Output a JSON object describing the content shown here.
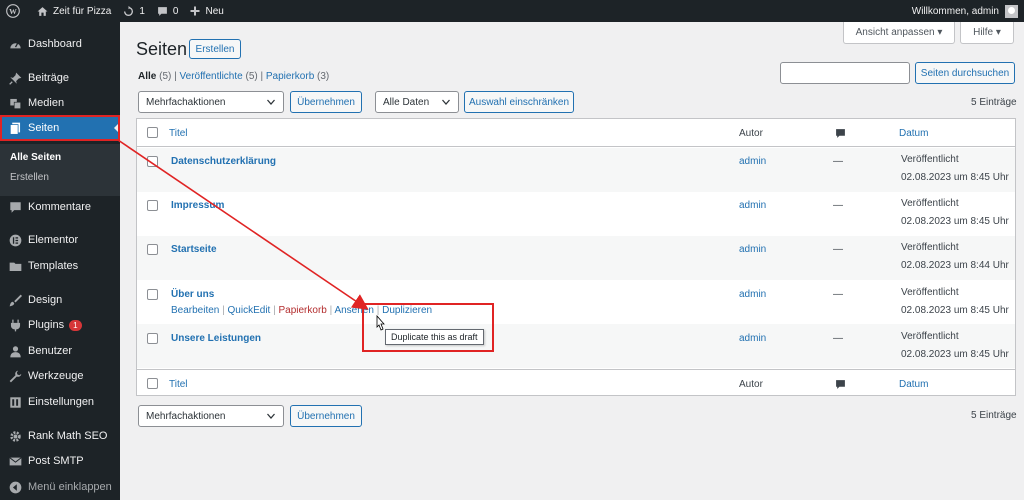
{
  "adminbar": {
    "site_name": "Zeit für Pizza",
    "updates_count": "1",
    "comments_count": "0",
    "new_label": "Neu",
    "greeting": "Willkommen, admin"
  },
  "sidebar": {
    "items": [
      {
        "label": "Dashboard",
        "icon": "dashboard-icon"
      },
      {
        "label": "Beiträge",
        "icon": "pin-icon"
      },
      {
        "label": "Medien",
        "icon": "media-icon"
      },
      {
        "label": "Seiten",
        "icon": "pages-icon"
      },
      {
        "label": "Kommentare",
        "icon": "comment-icon"
      },
      {
        "label": "Elementor",
        "icon": "elementor-icon"
      },
      {
        "label": "Templates",
        "icon": "folder-icon"
      },
      {
        "label": "Design",
        "icon": "brush-icon"
      },
      {
        "label": "Plugins",
        "icon": "plugin-icon"
      },
      {
        "label": "Benutzer",
        "icon": "user-icon"
      },
      {
        "label": "Werkzeuge",
        "icon": "wrench-icon"
      },
      {
        "label": "Einstellungen",
        "icon": "settings-icon"
      },
      {
        "label": "Rank Math SEO",
        "icon": "gear-icon"
      },
      {
        "label": "Post SMTP",
        "icon": "mail-icon"
      },
      {
        "label": "Menü einklappen",
        "icon": "collapse-icon"
      }
    ],
    "submenu": [
      "Alle Seiten",
      "Erstellen"
    ],
    "plugins_badge": "1"
  },
  "header": {
    "title": "Seiten",
    "add_new": "Erstellen",
    "screen_options": "Ansicht anpassen ▾",
    "help": "Hilfe ▾"
  },
  "filters": {
    "all": "Alle",
    "all_count": "(5)",
    "published": "Veröffentlichte",
    "published_count": "(5)",
    "trash": "Papierkorb",
    "trash_count": "(3)",
    "search_button": "Seiten durchsuchen",
    "bulk_actions": "Mehrfachaktionen",
    "apply": "Übernehmen",
    "all_dates": "Alle Daten",
    "filter_button": "Auswahl einschränken",
    "items_count": "5 Einträge"
  },
  "table": {
    "col_title": "Titel",
    "col_author": "Autor",
    "col_date": "Datum",
    "rows": [
      {
        "title": "Datenschutzerklärung",
        "author": "admin",
        "comments": "—",
        "status": "Veröffentlicht",
        "date": "02.08.2023 um 8:45 Uhr"
      },
      {
        "title": "Impressum",
        "author": "admin",
        "comments": "—",
        "status": "Veröffentlicht",
        "date": "02.08.2023 um 8:45 Uhr"
      },
      {
        "title": "Startseite",
        "author": "admin",
        "comments": "—",
        "status": "Veröffentlicht",
        "date": "02.08.2023 um 8:44 Uhr"
      },
      {
        "title": "Über uns",
        "author": "admin",
        "comments": "—",
        "status": "Veröffentlicht",
        "date": "02.08.2023 um 8:45 Uhr"
      },
      {
        "title": "Unsere Leistungen",
        "author": "admin",
        "comments": "—",
        "status": "Veröffentlicht",
        "date": "02.08.2023 um 8:45 Uhr"
      }
    ],
    "row_actions": {
      "edit": "Bearbeiten",
      "quick_edit": "QuickEdit",
      "trash": "Papierkorb",
      "view": "Ansehen",
      "duplicate": "Duplizieren"
    },
    "tooltip": "Duplicate this as draft"
  },
  "colors": {
    "accent": "#2271b1",
    "sidebar_bg": "#1d2327",
    "annotation": "#e02424"
  }
}
